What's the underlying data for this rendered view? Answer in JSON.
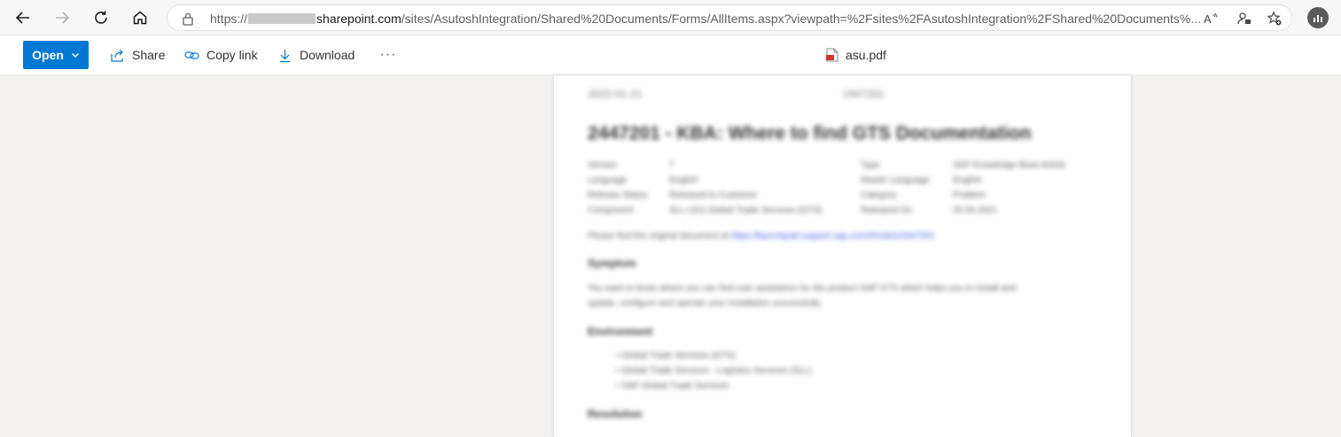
{
  "browser": {
    "url_prefix": "https://",
    "url_host": "sharepoint.com",
    "url_path": "/sites/AsutoshIntegration/Shared%20Documents/Forms/AllItems.aspx?viewpath=%2Fsites%2FAsutoshIntegration%2FShared%20Documents%..."
  },
  "toolbar": {
    "open_label": "Open",
    "share_label": "Share",
    "copy_link_label": "Copy link",
    "download_label": "Download",
    "more_label": "···",
    "file_name": "asu.pdf"
  },
  "colors": {
    "accent": "#0078d4",
    "background": "#f3f2f1",
    "pdf_icon": "#d9342b"
  },
  "document": {
    "date": "2022-01-21",
    "id": "2447201",
    "title": "2447201 - KBA: Where to find GTS Documentation",
    "meta_left": [
      {
        "label": "Version",
        "value": "7"
      },
      {
        "label": "Language",
        "value": "English"
      },
      {
        "label": "Release Status",
        "value": "Released to Customer"
      },
      {
        "label": "Component",
        "value": "SLL-LEG Global Trade Services (GTS)"
      }
    ],
    "meta_right": [
      {
        "label": "Type",
        "value": "SAP Knowledge Base Article"
      },
      {
        "label": "Master Language",
        "value": "English"
      },
      {
        "label": "Category",
        "value": "Problem"
      },
      {
        "label": "Released On",
        "value": "20.05.2021"
      }
    ],
    "intro_text": "Please find the original document at ",
    "intro_link": "https://launchpad.support.sap.com/#/notes/2447201",
    "symptom_heading": "Symptom",
    "symptom_line1": "You want to know where you can find user assistance for the product SAP GTS which helps you to install and",
    "symptom_line2": "update, configure and operate your installation successfully.",
    "environment_heading": "Environment",
    "environment_items": [
      "Global Trade Services (GTS)",
      "Global Trade Services - Logistics Services (SLL)",
      "SAP Global Trade Services"
    ],
    "resolution_heading": "Resolution"
  }
}
